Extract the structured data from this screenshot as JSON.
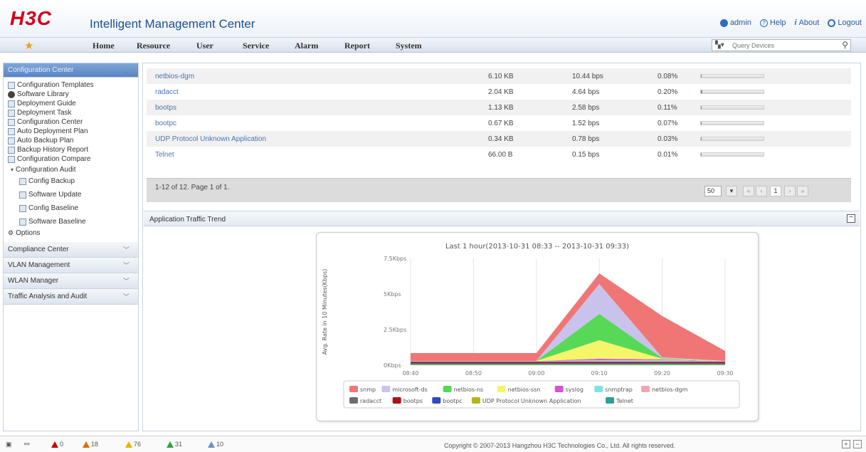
{
  "header": {
    "logo": "H3C",
    "title": "Intelligent Management Center",
    "links": {
      "admin": "admin",
      "help": "Help",
      "about": "About",
      "logout": "Logout"
    }
  },
  "nav": {
    "items": [
      "Home",
      "Resource",
      "User",
      "Service",
      "Alarm",
      "Report",
      "System"
    ],
    "search_placeholder": "Query Devices"
  },
  "sidebar": {
    "section_title": "Configuration Center",
    "items": [
      {
        "label": "Configuration Templates",
        "icon": "template-icon"
      },
      {
        "label": "Software Library",
        "icon": "disc-icon"
      },
      {
        "label": "Deployment Guide",
        "icon": "guide-icon"
      },
      {
        "label": "Deployment Task",
        "icon": "list-icon"
      },
      {
        "label": "Configuration Center",
        "icon": "config-icon"
      },
      {
        "label": "Auto Deployment Plan",
        "icon": "plan-icon"
      },
      {
        "label": "Auto Backup Plan",
        "icon": "plan-icon"
      },
      {
        "label": "Backup History Report",
        "icon": "report-icon"
      },
      {
        "label": "Configuration Compare",
        "icon": "compare-icon"
      }
    ],
    "audit": {
      "label": "Configuration Audit",
      "children": [
        "Config Backup",
        "Software Update",
        "Config Baseline",
        "Software Baseline"
      ]
    },
    "options": "Options",
    "collapsed": [
      "Compliance Center",
      "VLAN Management",
      "WLAN Manager",
      "Traffic Analysis and Audit"
    ]
  },
  "table": {
    "rows": [
      {
        "name": "netbios-dgm",
        "traffic": "6.10 KB",
        "rate": "10.44 bps",
        "percent": "0.08%",
        "share": 0.008
      },
      {
        "name": "radacct",
        "traffic": "2.04 KB",
        "rate": "4.64 bps",
        "percent": "0.20%",
        "share": 0.02
      },
      {
        "name": "bootps",
        "traffic": "1.13 KB",
        "rate": "2.58 bps",
        "percent": "0.11%",
        "share": 0.011
      },
      {
        "name": "bootpc",
        "traffic": "0.67 KB",
        "rate": "1.52 bps",
        "percent": "0.07%",
        "share": 0.007
      },
      {
        "name": "UDP Protocol Unknown Application",
        "traffic": "0.34 KB",
        "rate": "0.78 bps",
        "percent": "0.03%",
        "share": 0.003
      },
      {
        "name": "Telnet",
        "traffic": "66.00 B",
        "rate": "0.15 bps",
        "percent": "0.01%",
        "share": 0.001
      }
    ],
    "pager_info": "1-12 of 12. Page 1 of 1.",
    "page_size": "50",
    "current_page": "1"
  },
  "trend": {
    "panel_title": "Application Traffic Trend"
  },
  "chart_data": {
    "type": "area",
    "title": "Last 1 hour(2013-10-31 08:33 -- 2013-10-31 09:33)",
    "ylabel": "Avg. Rate in 10 Minutes(Kbps)",
    "xlabel": "",
    "x": [
      "08:40",
      "08:50",
      "09:00",
      "09:10",
      "09:20",
      "09:30"
    ],
    "y_ticks": [
      "0Kbps",
      "2.5Kbps",
      "5Kbps",
      "7.5Kbps"
    ],
    "ylim": [
      0,
      7.5
    ],
    "series": [
      {
        "name": "Telnet",
        "color": "#2aa198",
        "values": [
          0.05,
          0.05,
          0.05,
          0.05,
          0.05,
          0.05
        ]
      },
      {
        "name": "UDP Protocol Unknown Application",
        "color": "#b5b51c",
        "values": [
          0.05,
          0.05,
          0.05,
          0.05,
          0.05,
          0.05
        ]
      },
      {
        "name": "bootpc",
        "color": "#3348c4",
        "values": [
          0.05,
          0.05,
          0.05,
          0.05,
          0.05,
          0.05
        ]
      },
      {
        "name": "bootps",
        "color": "#b0101a",
        "values": [
          0.05,
          0.05,
          0.05,
          0.05,
          0.05,
          0.05
        ]
      },
      {
        "name": "radacct",
        "color": "#6e6e6e",
        "values": [
          0.05,
          0.05,
          0.05,
          0.05,
          0.05,
          0.05
        ]
      },
      {
        "name": "netbios-dgm",
        "color": "#f2a6b0",
        "values": [
          0.05,
          0.05,
          0.05,
          0.05,
          0.05,
          0.05
        ]
      },
      {
        "name": "snmptrap",
        "color": "#7fe3e8",
        "values": [
          0,
          0,
          0,
          0.05,
          0.05,
          0
        ]
      },
      {
        "name": "syslog",
        "color": "#d653d6",
        "values": [
          0,
          0,
          0,
          0.1,
          0.05,
          0
        ]
      },
      {
        "name": "netbios-ssn",
        "color": "#f5f56a",
        "values": [
          0,
          0,
          0,
          1.3,
          0.05,
          0
        ]
      },
      {
        "name": "netbios-ns",
        "color": "#57d957",
        "values": [
          0,
          0,
          0,
          1.85,
          0.05,
          0
        ]
      },
      {
        "name": "microsoft-ds",
        "color": "#c8c2ec",
        "values": [
          0,
          0,
          0,
          2.1,
          0.05,
          0
        ]
      },
      {
        "name": "snmp",
        "color": "#f07676",
        "values": [
          0.55,
          0.55,
          0.55,
          0.75,
          2.9,
          0.7
        ]
      }
    ],
    "legend": [
      "snmp",
      "microsoft-ds",
      "netbios-ns",
      "netbios-ssn",
      "syslog",
      "snmptrap",
      "netbios-dgm",
      "radacct",
      "bootps",
      "bootpc",
      "UDP Protocol Unknown Application",
      "Telnet"
    ],
    "legend_position": "bottom"
  },
  "statusbar": {
    "alarms": [
      "0",
      "18",
      "76",
      "31",
      "10"
    ],
    "copyright": "Copyright © 2007-2013 Hangzhou H3C Technologies Co., Ltd. All rights reserved."
  }
}
